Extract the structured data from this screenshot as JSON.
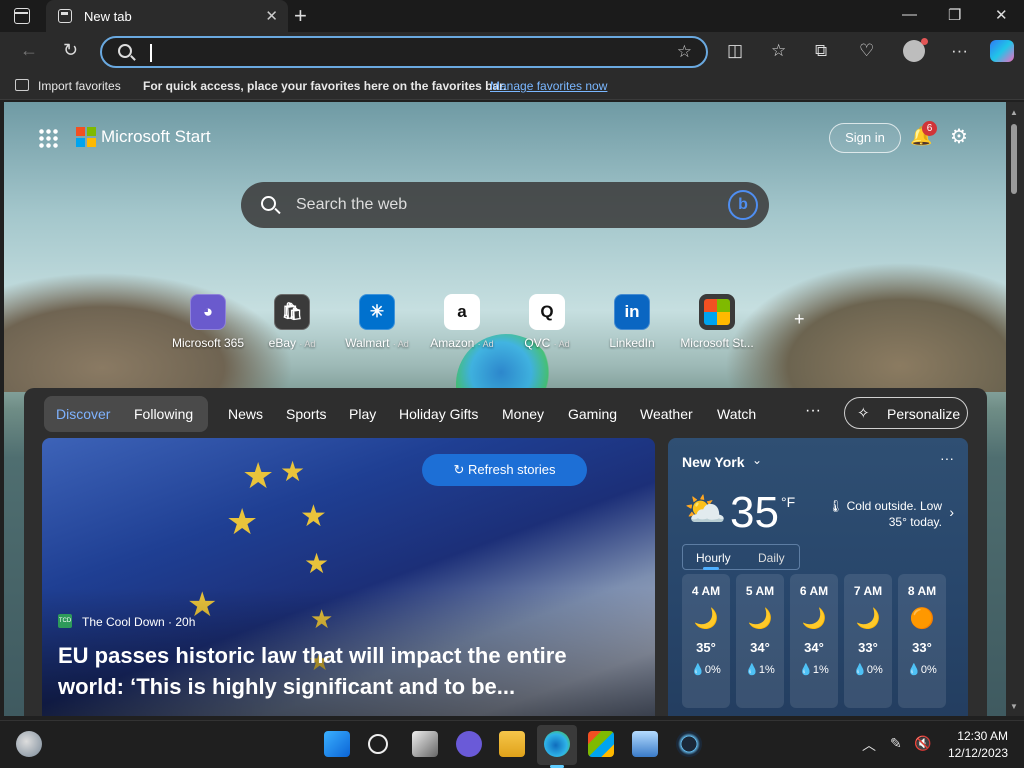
{
  "titlebar": {
    "tab_title": "New tab",
    "close_tab": "✕",
    "new_tab": "+",
    "minimize": "—",
    "restore": "❐",
    "close_window": "✕"
  },
  "navbar": {
    "back": "←",
    "refresh": "↻",
    "address_value": "",
    "favorite_star": "☆",
    "split_screen": "◫",
    "favorites": "☆",
    "collections": "⧉",
    "performance": "♡",
    "more": "···"
  },
  "favorites_bar": {
    "import_label": "Import favorites",
    "hint": "For quick access, place your favorites here on the favorites bar.",
    "manage_link": "Manage favorites now"
  },
  "start": {
    "brand": "Microsoft Start",
    "sign_in": "Sign in",
    "notification_count": "6",
    "bell": "🔔",
    "gear": "⚙",
    "search_placeholder": "Search the web",
    "bing_glyph": "b",
    "plus": "+"
  },
  "quick_links": [
    {
      "label": "Microsoft 365",
      "ad": "",
      "glyph": "◕",
      "color": "#6a5acd"
    },
    {
      "label": "eBay",
      "ad": "· Ad",
      "glyph": "🛍",
      "color": "#3a3a3a"
    },
    {
      "label": "Walmart",
      "ad": "· Ad",
      "glyph": "✳",
      "color": "#0071ce"
    },
    {
      "label": "Amazon",
      "ad": "· Ad",
      "glyph": "a",
      "color": "#ffffff"
    },
    {
      "label": "QVC",
      "ad": "· Ad",
      "glyph": "Q",
      "color": "#ffffff"
    },
    {
      "label": "LinkedIn",
      "ad": "",
      "glyph": "in",
      "color": "#0a66c2"
    },
    {
      "label": "Microsoft St...",
      "ad": "",
      "glyph": "",
      "color": "#3a3a3a"
    }
  ],
  "feed_nav": {
    "discover": "Discover",
    "following": "Following",
    "items": [
      "News",
      "Sports",
      "Play",
      "Holiday Gifts",
      "Money",
      "Gaming",
      "Weather",
      "Watch"
    ],
    "more": "···",
    "personalize": "Personalize",
    "personalize_icon": "✧"
  },
  "hero": {
    "refresh_label": "↻ Refresh stories",
    "source": "The Cool Down · 20h",
    "source_badge": "TCD",
    "headline": "EU passes historic law that will impact the entire world: ‘This is highly significant and to be..."
  },
  "weather": {
    "city": "New York",
    "chevron": "⌄",
    "more": "···",
    "icon": "⛅",
    "temp": "35",
    "unit": "°F",
    "note": "🌡 Cold outside. Low 35° today.",
    "next": "›",
    "tab_hourly": "Hourly",
    "tab_daily": "Daily",
    "hours": [
      {
        "time": "4 AM",
        "icon": "🌙",
        "temp": "35°",
        "precip": "💧0%"
      },
      {
        "time": "5 AM",
        "icon": "🌙",
        "temp": "34°",
        "precip": "💧1%"
      },
      {
        "time": "6 AM",
        "icon": "🌙",
        "temp": "34°",
        "precip": "💧1%"
      },
      {
        "time": "7 AM",
        "icon": "🌙",
        "temp": "33°",
        "precip": "💧0%"
      },
      {
        "time": "8 AM",
        "icon": "🟠",
        "temp": "33°",
        "precip": "💧0%"
      }
    ]
  },
  "taskbar": {
    "time": "12:30 AM",
    "date": "12/12/2023",
    "tray_chevron": "︿",
    "tray_pen": "✎",
    "tray_net": "🔇"
  }
}
